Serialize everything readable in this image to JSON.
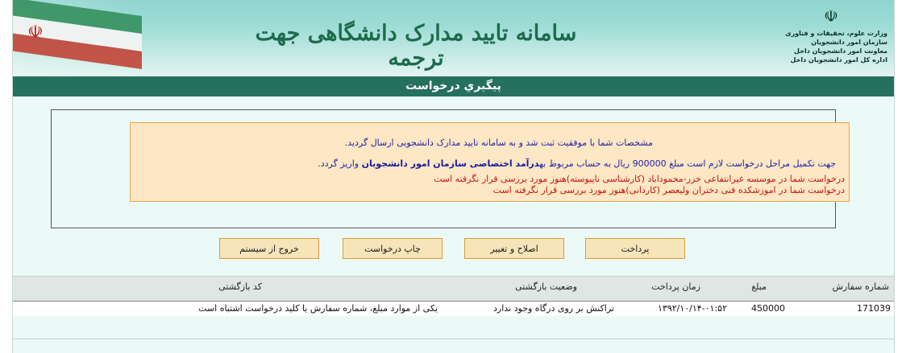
{
  "header": {
    "system_title": "سامانه تایید مدارک دانشگاهی جهت ترجمه",
    "ministry_lines": [
      "وزارت علوم، تحقیقات و فناوری",
      "سازمان امور دانشجویان",
      "معاونت امور دانشجویان داخل",
      "اداره کل امور دانشجویان داخل"
    ]
  },
  "page_title": "پيگيري درخواست",
  "message": {
    "line1": "مشخصات شما با موفقیت ثبت شد و به سامانه تایید مدارک دانشجویی ارسال گردید.",
    "line2_pre": "جهت تکمیل مراحل درخواست لازم است مبلغ 900000 ریال به حساب مربوط به",
    "line2_bold": "درآمد اختصاصی سازمان امور دانشجویان",
    "line2_post": " واریز گردد.",
    "status_lines": [
      "درخواست شما در موسسه غیرانتفاعی خزر-محموداباد (کارشناسی ناپیوسته)هنوز مورد بررسی قرار نگرفته است",
      "درخواست شما در اموزشکده فنی دختران ولیعصر (کاردانی)هنوز مورد بررسی قرار نگرفته است"
    ]
  },
  "buttons": {
    "payment": "پرداخت",
    "edit": "اصلاح و تغییر",
    "print": "چاپ درخواست",
    "logout": "خروج از سیستم"
  },
  "table": {
    "headers": {
      "order_number": "شماره سفارش",
      "amount": "مبلغ",
      "payment_time": "زمان پرداخت",
      "return_status": "وضعیت بازگشتی",
      "return_code": "کد بازگشتی"
    },
    "rows": [
      {
        "order_number": "171039",
        "amount": "450000",
        "payment_time": "۱۳۹۲/۱۰/۱۴-۰۱:۵۲",
        "return_status": "تراکنش بر روی درگاه وجود ندارد",
        "return_code": "یکی از موارد مبلغ، شماره سفارش یا کلید درخواست اشتباه است"
      }
    ]
  },
  "colors": {
    "title_bar": "#26705e",
    "message_bg": "#fde7c4",
    "message_border": "#e8a64a",
    "button_bg": "#f8e4b9",
    "error_text": "#cc1111",
    "info_text": "#2222aa"
  }
}
